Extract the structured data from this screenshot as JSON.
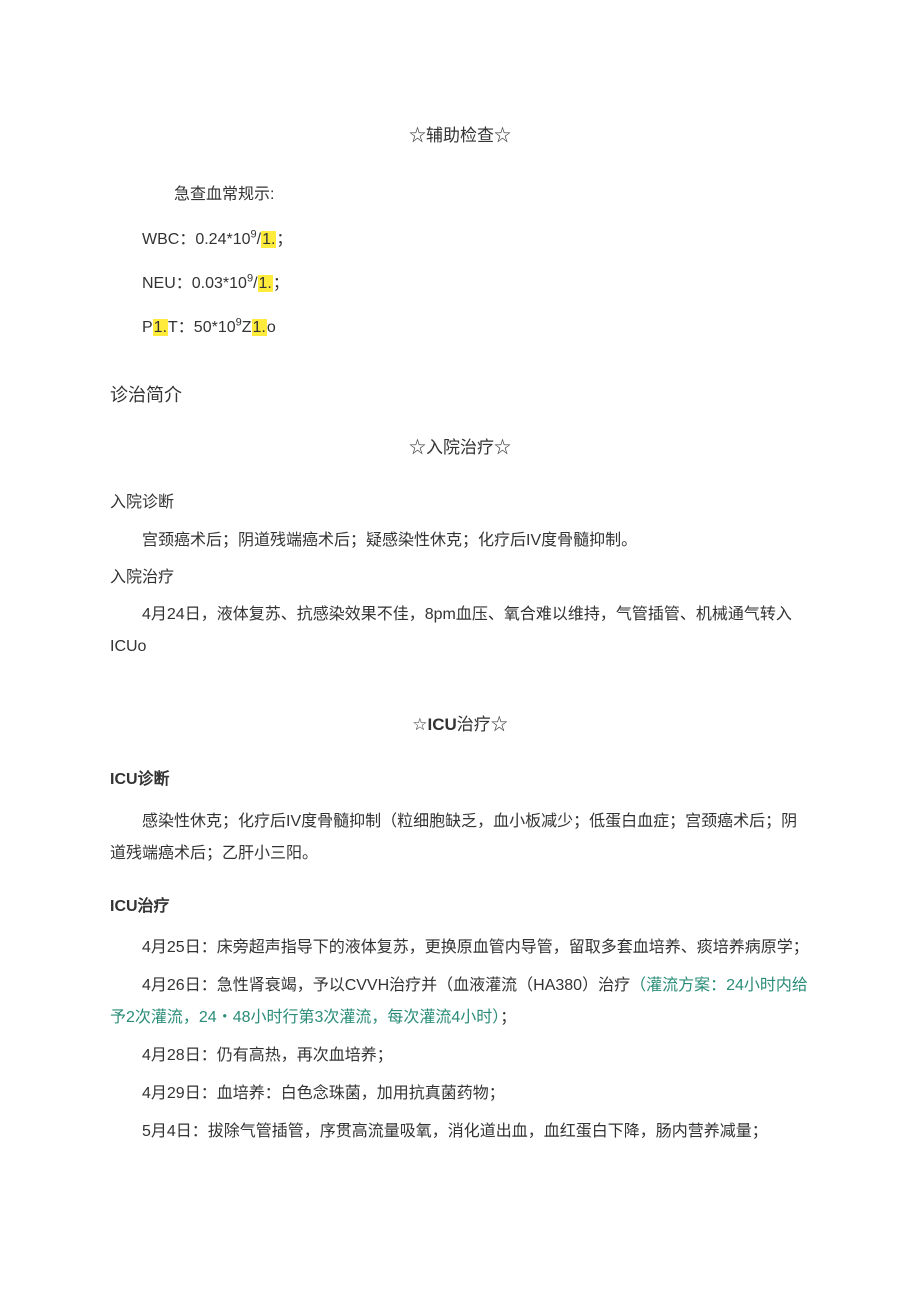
{
  "aux_exam": {
    "title": "☆辅助检查☆",
    "intro": "急查血常规示:",
    "wbc": "WBC：0.24*10",
    "wbc_sup": "9",
    "wbc_tail_hl": "1.",
    "wbc_tail": "；",
    "wbc_slash": "/",
    "neu": "NEU：0.03*10",
    "neu_sup": "9",
    "neu_tail_hl": "1.",
    "neu_tail": "；",
    "neu_slash": "/",
    "plt_pre": "P",
    "plt_hl1": "1.",
    "plt_mid": "T：50*10",
    "plt_sup": "9",
    "plt_z": "Z",
    "plt_hl2": "1.",
    "plt_tail": "o"
  },
  "diag_brief": {
    "heading": "诊治简介"
  },
  "admission": {
    "title": "☆入院治疗☆",
    "diag_heading": "入院诊断",
    "diag_text": "宫颈癌术后；阴道残端癌术后；疑感染性休克；化疗后IV度骨髓抑制。",
    "treat_heading": "入院治疗",
    "treat_text": "4月24日，液体复苏、抗感染效果不佳，8pm血压、氧合难以维持，气管插管、机械通气转入ICUo"
  },
  "icu": {
    "title_pre": "☆",
    "title_bold": "ICU",
    "title_post": "治疗☆",
    "diag_heading": "ICU诊断",
    "diag_text": "感染性休克；化疗后IV度骨髓抑制（粒细胞缺乏，血小板减少；低蛋白血症；宫颈癌术后；阴道残端癌术后；乙肝小三阳。",
    "treat_heading": "ICU治疗",
    "d1": "4月25日：床旁超声指导下的液体复苏，更换原血管内导管，留取多套血培养、痰培养病原学；",
    "d2_pre": "4月26日：急性肾衰竭，予以CVVH治疗并（血液灌流（HA380）治疗",
    "d2_teal": "（灌流方案：24小时内给予2次灌流，24・48小时行第3次灌流，每次灌流4小时）",
    "d2_post": "；",
    "d3": "4月28日：仍有高热，再次血培养；",
    "d4": "4月29日：血培养：白色念珠菌，加用抗真菌药物；",
    "d5": "5月4日：拔除气管插管，序贯高流量吸氧，消化道出血，血红蛋白下降，肠内营养减量；"
  }
}
